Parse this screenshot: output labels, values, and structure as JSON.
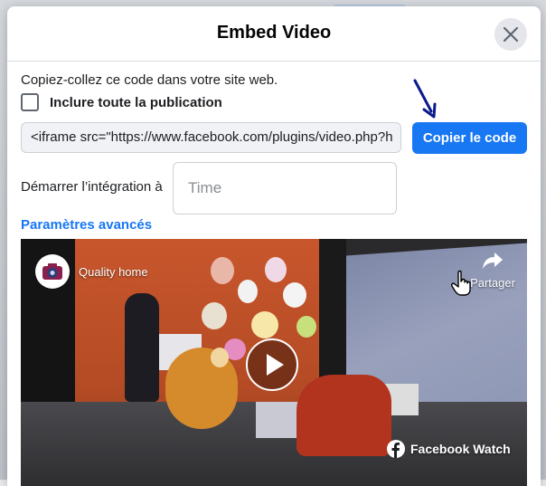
{
  "dialog": {
    "title": "Embed Video",
    "instruction": "Copiez-collez ce code dans votre site web.",
    "include_post_label": "Inclure toute la publication",
    "include_post_checked": false,
    "embed_code": "<iframe src=\"https://www.facebook.com/plugins/video.php?h",
    "copy_button_label": "Copier le code",
    "start_label": "Démarrer l’intégration à",
    "time_placeholder": "Time",
    "time_value": "",
    "advanced_link": "Paramètres avancés"
  },
  "video": {
    "channel_name": "Quality home",
    "share_label": "Partager",
    "watch_label": "Facebook Watch"
  },
  "icons": {
    "close": "close-icon",
    "share": "share-arrow-icon",
    "play": "play-icon",
    "facebook": "facebook-logo-icon",
    "cursor": "hand-pointer-icon",
    "annotation": "annotation-arrow-icon"
  },
  "colors": {
    "accent": "#1877f2",
    "annotation_arrow": "#0a1a8c"
  }
}
